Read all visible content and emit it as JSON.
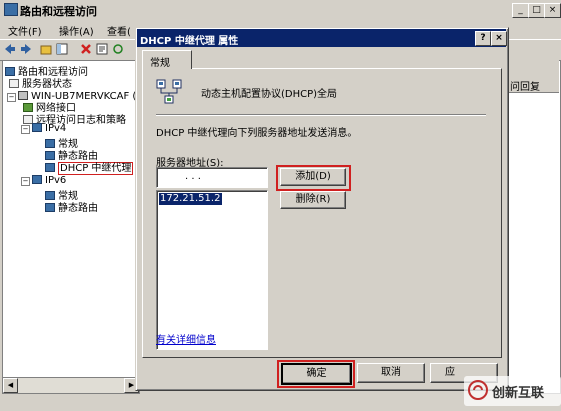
{
  "main": {
    "title": "路由和远程访问",
    "controls": [
      "_",
      "□",
      "×"
    ]
  },
  "menubar": {
    "file": "文件(F)",
    "action": "操作(A)",
    "view": "查看("
  },
  "tree": {
    "items": [
      {
        "label": "路由和远程访问"
      },
      {
        "label": "服务器状态"
      },
      {
        "label": "WIN-UB7MERVKCAF (本"
      },
      {
        "label": "网络接口"
      },
      {
        "label": "远程访问日志和策略"
      },
      {
        "label": "IPv4"
      },
      {
        "label": "常规"
      },
      {
        "label": "静态路由"
      },
      {
        "label": "DHCP 中继代理"
      },
      {
        "label": "IPv6"
      },
      {
        "label": "常规"
      },
      {
        "label": "静态路由"
      }
    ]
  },
  "right_pane": {
    "column_header": "问回复"
  },
  "dialog": {
    "title": "DHCP 中继代理 属性",
    "help_btn": "?",
    "close_btn": "×",
    "tab_general": "常规",
    "protocol_name": "动态主机配置协议(DHCP)全局",
    "description": "DHCP 中继代理向下列服务器地址发送消息。",
    "server_label": "服务器地址(S):",
    "ip_dots": ".  .  .",
    "add_btn": "添加(D)",
    "remove_btn": "删除(R)",
    "servers": [
      "172.21.51.2"
    ],
    "more_info_link": "有关详细信息",
    "ok_btn": "确定",
    "cancel_btn": "取消",
    "apply_btn": "应"
  },
  "watermark": {
    "text": "创新互联"
  }
}
